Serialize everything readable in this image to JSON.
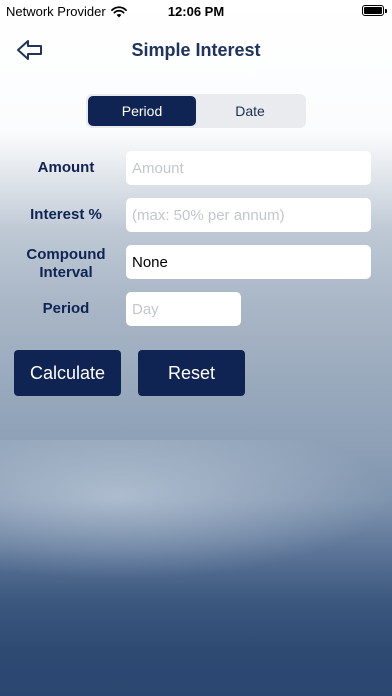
{
  "status_bar": {
    "carrier": "Network Provider",
    "time": "12:06 PM"
  },
  "header": {
    "title": "Simple Interest"
  },
  "segment": {
    "options": [
      "Period",
      "Date"
    ],
    "selected": "Period"
  },
  "form": {
    "amount": {
      "label": "Amount",
      "placeholder": "Amount"
    },
    "interest": {
      "label": "Interest %",
      "placeholder": "(max: 50% per annum)"
    },
    "compound": {
      "label_line1": "Compound",
      "label_line2": "Interval",
      "value": "None"
    },
    "period": {
      "label": "Period",
      "placeholder": "Day"
    }
  },
  "buttons": {
    "calculate": "Calculate",
    "reset": "Reset"
  },
  "colors": {
    "primary": "#0f2453",
    "title": "#1d3360"
  }
}
